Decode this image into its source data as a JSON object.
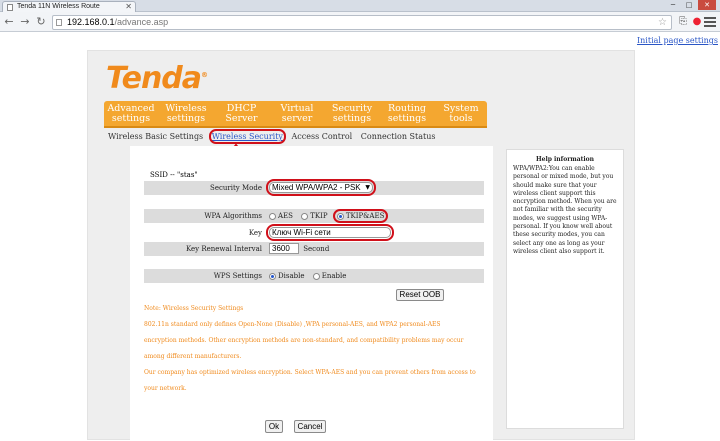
{
  "browser": {
    "tab_title": "Tenda 11N Wireless Route",
    "url_host": "192.168.0.1",
    "url_path": "/advance.asp"
  },
  "page": {
    "initial_link": "Initial page settings",
    "logo": "Tenda",
    "logo_mark": "®"
  },
  "main_nav": [
    {
      "line1": "Advanced",
      "line2": "settings"
    },
    {
      "line1": "Wireless",
      "line2": "settings"
    },
    {
      "line1": "DHCP",
      "line2": "Server"
    },
    {
      "line1": "Virtual",
      "line2": "server"
    },
    {
      "line1": "Security",
      "line2": "settings"
    },
    {
      "line1": "Routing",
      "line2": "settings"
    },
    {
      "line1": "System",
      "line2": "tools"
    }
  ],
  "sub_nav": [
    "Wireless Basic Settings",
    "Wireless Security",
    "Access Control",
    "Connection Status"
  ],
  "form": {
    "ssid_text": "SSID -- \"stas\"",
    "security_mode_label": "Security Mode",
    "security_mode_value": "Mixed WPA/WPA2 - PSK",
    "wpa_algorithms_label": "WPA Algorithms",
    "alg_aes": "AES",
    "alg_tkip": "TKIP",
    "alg_tkipaes": "TKIP&AES",
    "key_label": "Key",
    "key_value": "Ключ Wi-Fi сети",
    "key_renewal_label": "Key Renewal Interval",
    "key_renewal_value": "3600",
    "key_renewal_unit": "Second",
    "wps_label": "WPS Settings",
    "wps_disable": "Disable",
    "wps_enable": "Enable",
    "reset_oob": "Reset OOB",
    "ok": "Ok",
    "cancel": "Cancel"
  },
  "notes": [
    "Note: Wireless Security Settings",
    "802.11n standard only defines Open-None (Disable) ,WPA personal-AES, and WPA2 personal-AES",
    "encryption methods. Other encryption methods are non-standard, and compatibility problems may occur",
    "among different manufacturers.",
    "Our company has optimized wireless encryption. Select WPA-AES and you can prevent others from access to",
    "your network."
  ],
  "help": {
    "title": "Help information",
    "body": "WPA/WPA2:You can enable personal or mixed mode, but you should make sure that your wireless client support this encryption method. When you are not familiar with the security modes, we suggest using WPA-personal. If you know well about these security modes, you can select any one as long as your wireless client also support it."
  },
  "colors": {
    "brand_orange": "#f08a1c",
    "nav_orange": "#f4a730",
    "annotation_red": "#d0101a"
  }
}
